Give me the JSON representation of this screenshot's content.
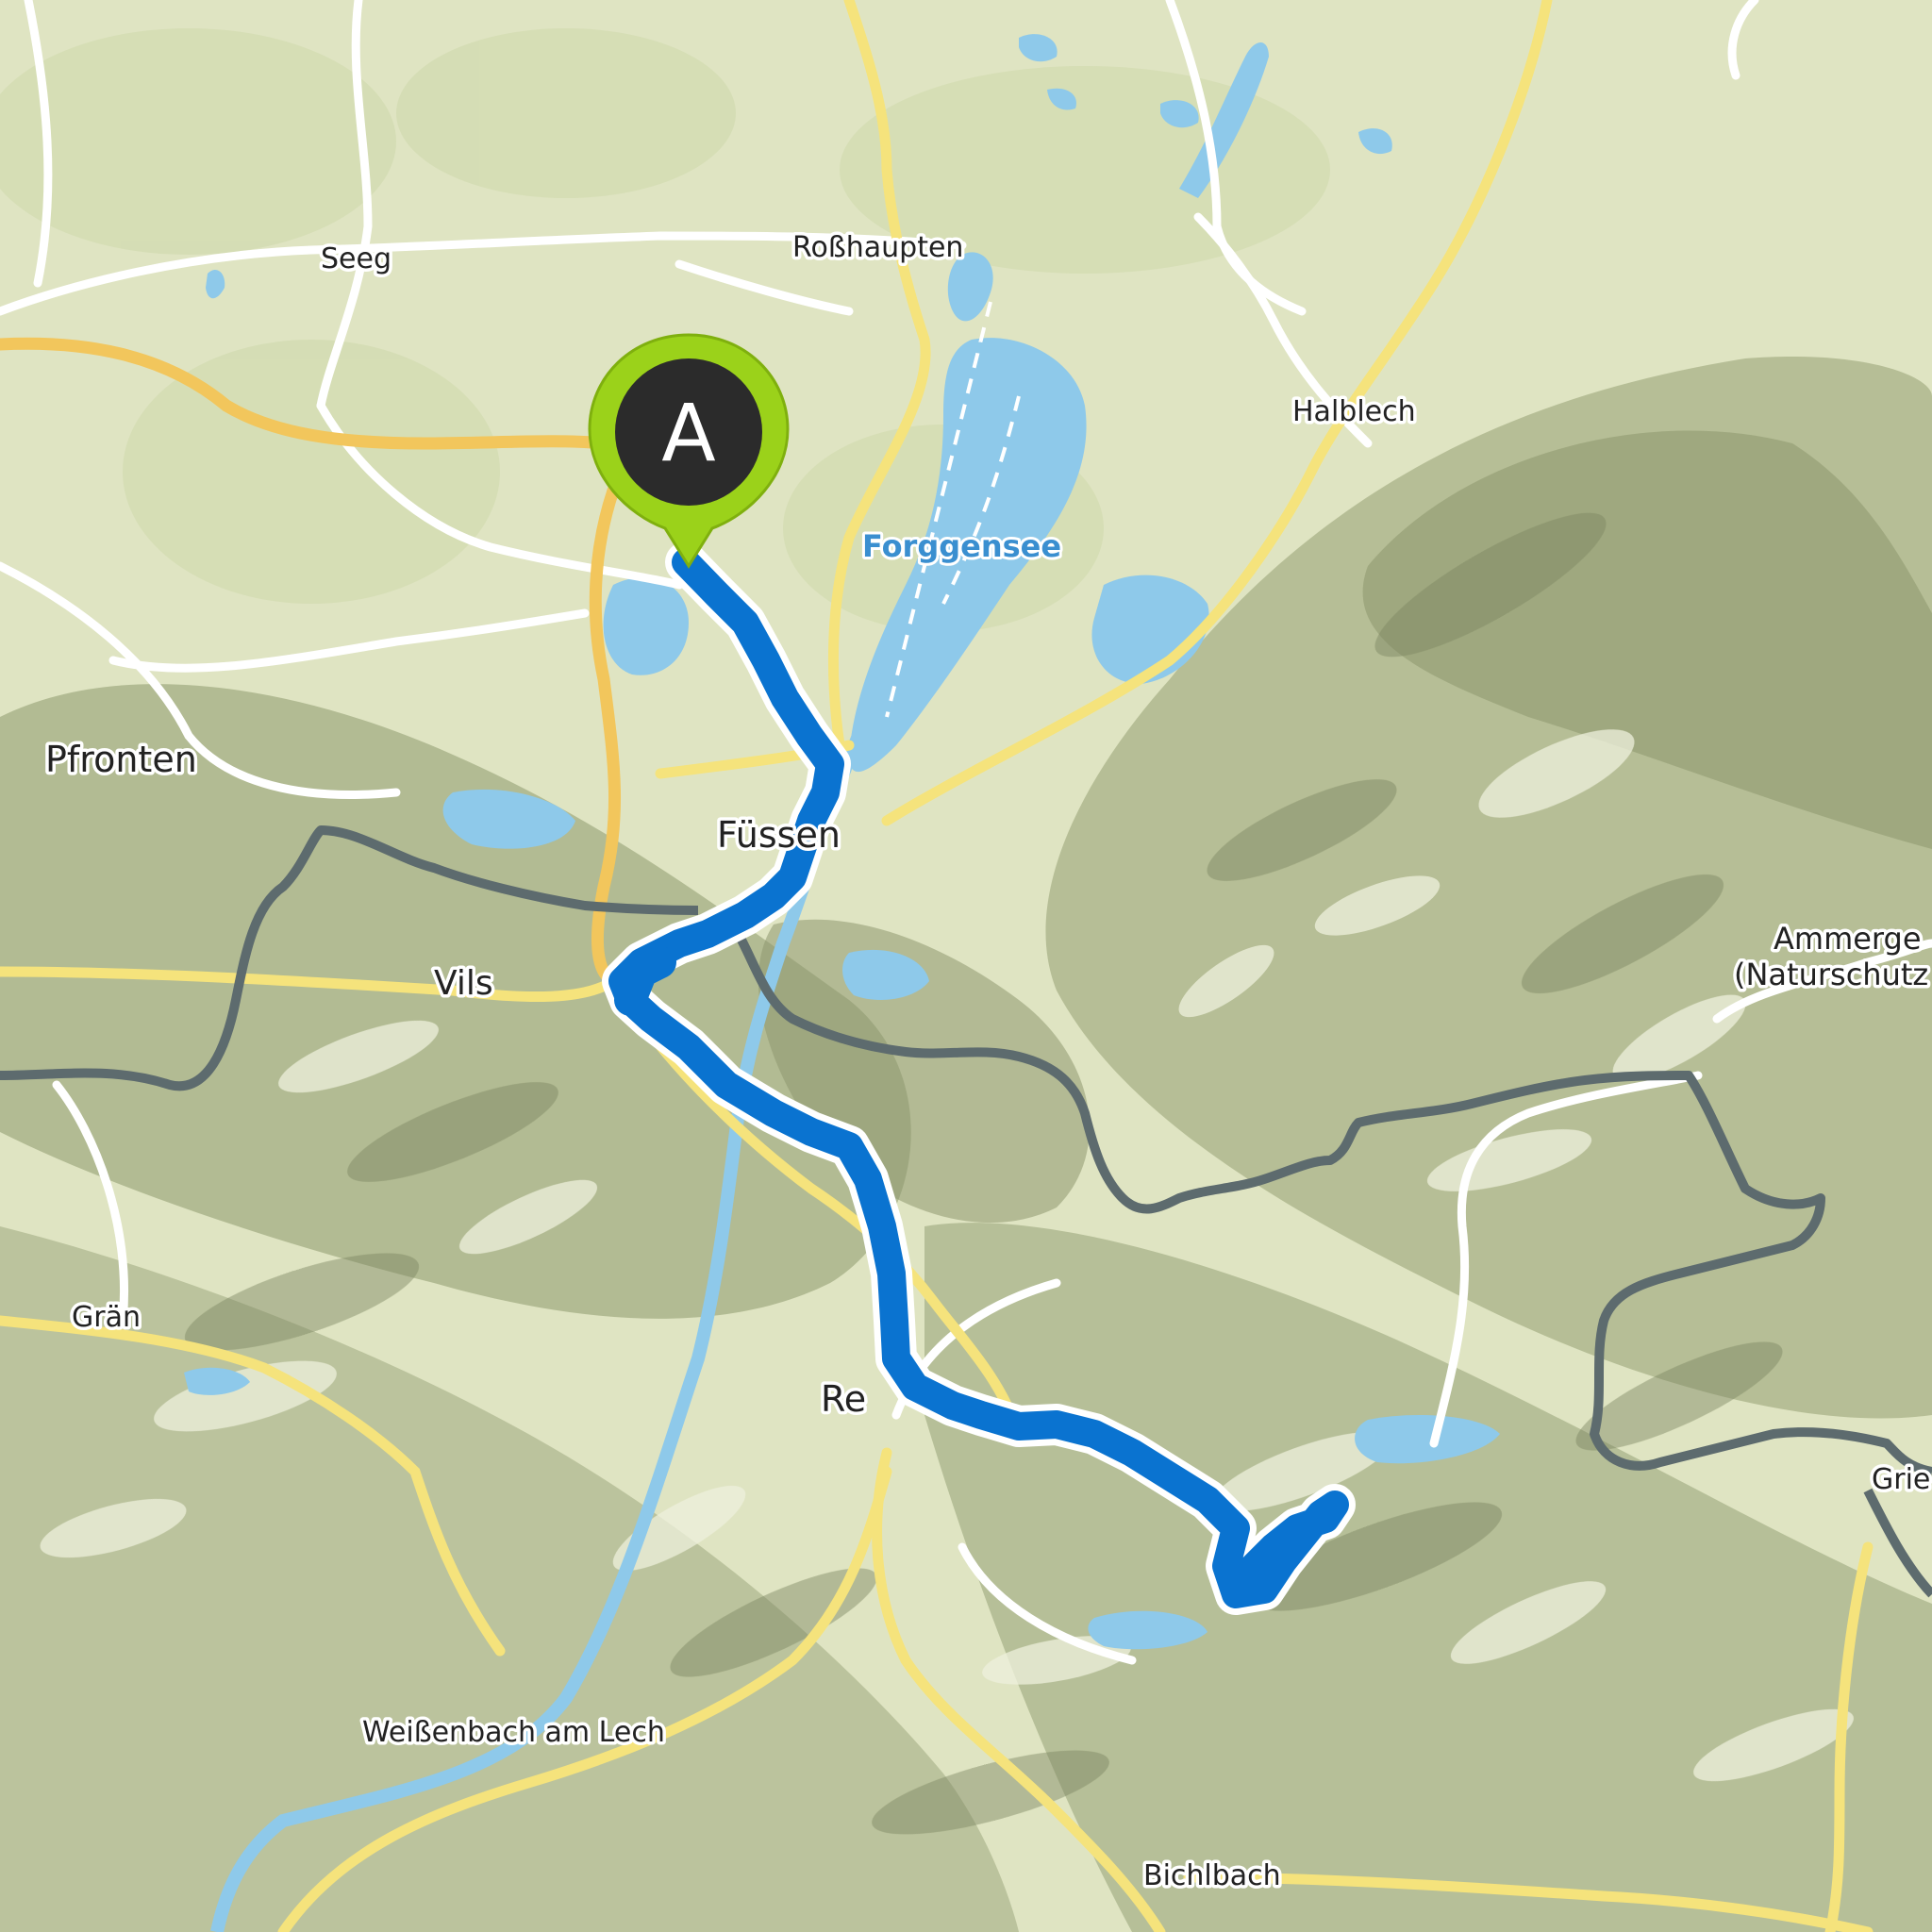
{
  "map": {
    "start_marker": {
      "letter": "A",
      "color": "#9bd21a",
      "inner_color": "#2b2b2b"
    },
    "route": {
      "color": "#0a73d0",
      "outline": "#ffffff"
    },
    "colors": {
      "lowland": "#dfe4c2",
      "mountain_shadow": "#98a27a",
      "water": "#8ec9ea",
      "road_major": "#f2c65c",
      "road_secondary": "#f5e37c",
      "road_minor": "#ffffff",
      "border": "#5d6b6e"
    },
    "places": {
      "seeg": "Seeg",
      "rosshaupten": "Roßhaupten",
      "halblech": "Halblech",
      "pfronten": "Pfronten",
      "fuessen": "Füssen",
      "vils": "Vils",
      "ammergebirge_1": "Ammerge",
      "ammergebirge_2": "(Naturschutz",
      "graen": "Grän",
      "reutte": "Re",
      "grie": "Grie",
      "weissenbach": "Weißenbach am Lech",
      "bichlbach": "Bichlbach"
    },
    "lakes": {
      "forggensee": "Forggensee"
    }
  }
}
